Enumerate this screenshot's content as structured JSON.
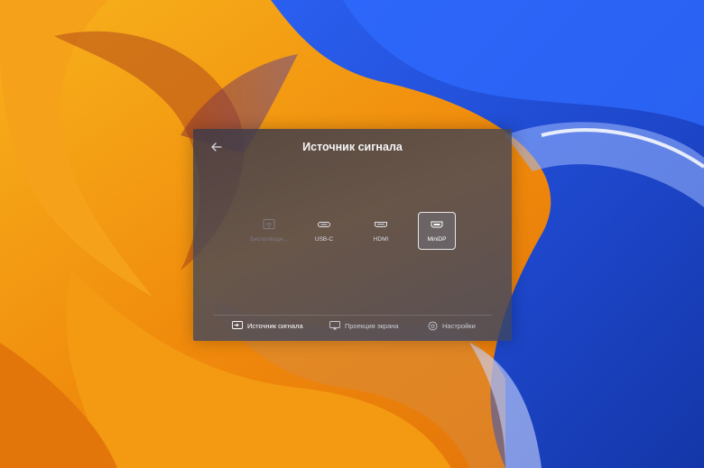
{
  "dialog": {
    "title": "Источник сигнала",
    "back_icon": "arrow-left-icon"
  },
  "sources": [
    {
      "label": "Беспроводн...",
      "icon": "wifi-cast-icon",
      "state": "disabled"
    },
    {
      "label": "USB-C",
      "icon": "usb-c-port-icon",
      "state": "normal"
    },
    {
      "label": "HDMI",
      "icon": "hdmi-port-icon",
      "state": "normal"
    },
    {
      "label": "MiniDP",
      "icon": "minidp-port-icon",
      "state": "selected"
    }
  ],
  "bottom_nav": [
    {
      "label": "Источник сигнала",
      "icon": "input-source-icon",
      "active": true
    },
    {
      "label": "Проекция экрана",
      "icon": "screen-projection-icon",
      "active": false
    },
    {
      "label": "Настройки",
      "icon": "gear-icon",
      "active": false
    }
  ],
  "colors": {
    "wallpaper_orange": "#f39a12",
    "wallpaper_blue": "#1f4fd8",
    "dialog_bg": "#3e3a46"
  }
}
